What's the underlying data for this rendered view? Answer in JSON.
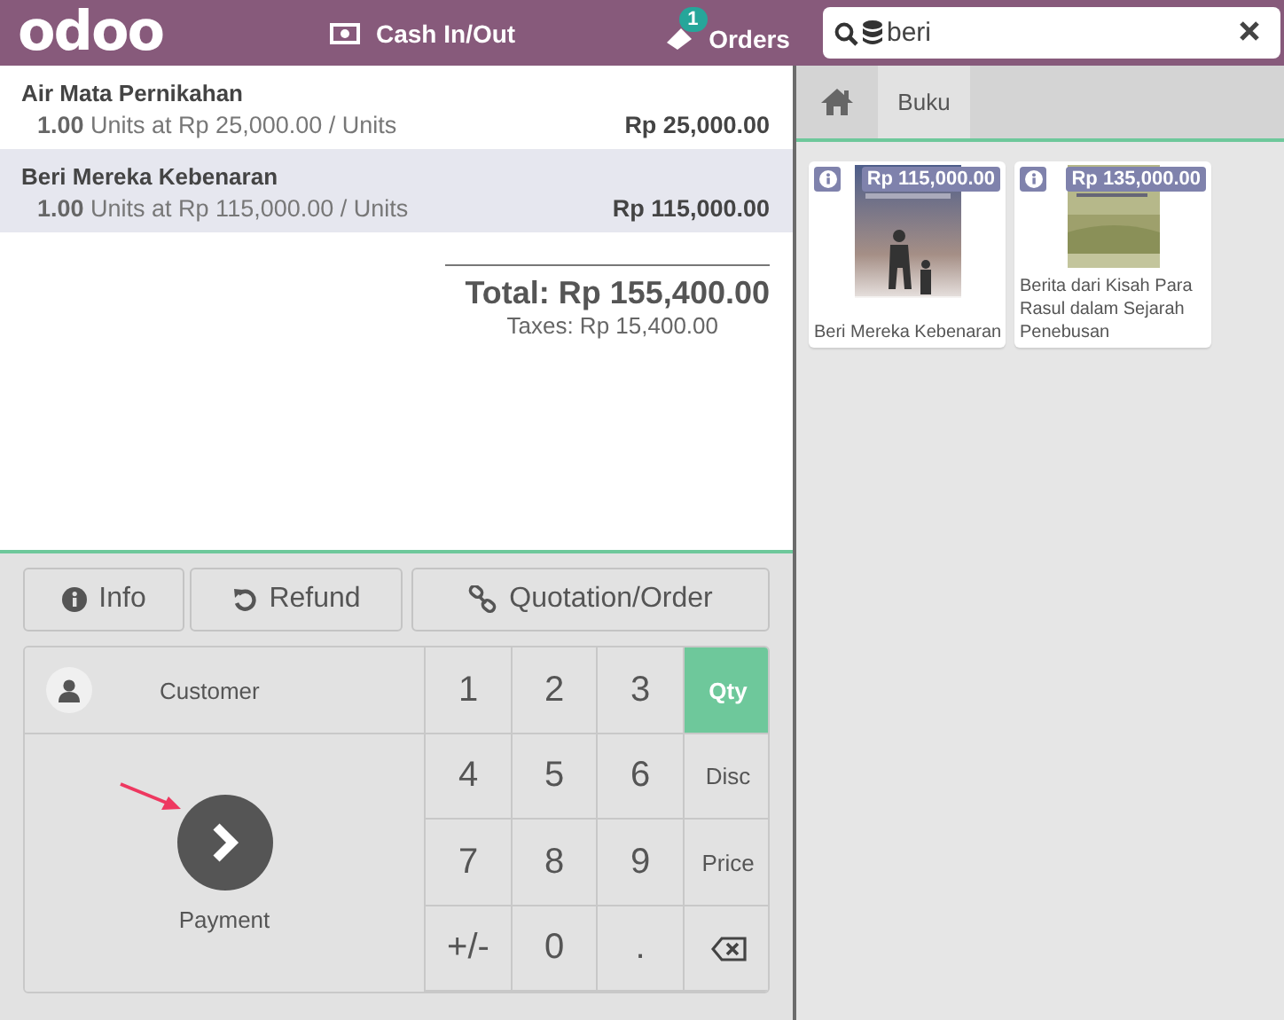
{
  "header": {
    "logo": "odoo",
    "cash_button": "Cash In/Out",
    "orders_button": "Orders",
    "orders_count": "1",
    "search": {
      "value": "beri"
    }
  },
  "order": {
    "lines": [
      {
        "name": "Air Mata Pernikahan",
        "quantity": "1.00",
        "unit_text": "Units at Rp 25,000.00 / Units",
        "price": "Rp 25,000.00",
        "selected": false
      },
      {
        "name": "Beri Mereka Kebenaran",
        "quantity": "1.00",
        "unit_text": "Units at Rp 115,000.00 / Units",
        "price": "Rp 115,000.00",
        "selected": true
      }
    ],
    "total": "Total: Rp 155,400.00",
    "taxes": "Taxes: Rp 15,400.00"
  },
  "control_buttons": [
    {
      "label": "Info",
      "kind": "info"
    },
    {
      "label": "Refund",
      "kind": "refund"
    },
    {
      "label": "Quotation/Order",
      "kind": "link"
    }
  ],
  "actionpad": {
    "customer": "Customer",
    "payment": "Payment"
  },
  "numpad": {
    "keys": [
      "1",
      "2",
      "3",
      "4",
      "5",
      "6",
      "7",
      "8",
      "9",
      "+/-",
      "0",
      "."
    ],
    "modes": [
      {
        "label": "Qty",
        "selected": true
      },
      {
        "label": "Disc",
        "selected": false
      },
      {
        "label": "Price",
        "selected": false
      }
    ]
  },
  "breadcrumb": [
    {
      "label": "Buku"
    }
  ],
  "products": [
    {
      "name": "Beri Mereka Kebenaran",
      "price": "Rp 115,000.00",
      "kind": "picture"
    },
    {
      "name": "Berita dari Kisah Para Rasul dalam Sejarah Penebusan",
      "price": "Rp 135,000.00",
      "kind": "picture"
    }
  ]
}
